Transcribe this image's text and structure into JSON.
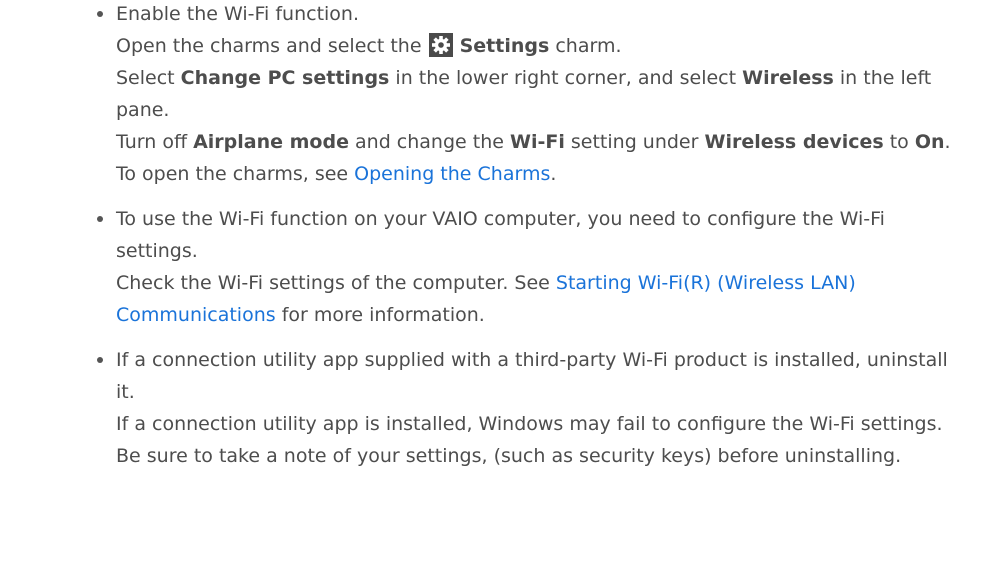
{
  "items": [
    {
      "heading": "Enable the Wi-Fi function.",
      "l1_pre": "Open the charms and select the ",
      "l1_bold": "Settings",
      "l1_post": " charm.",
      "l2_pre": "Select ",
      "l2_bold1": "Change PC settings",
      "l2_mid": " in the lower right corner, and select ",
      "l2_bold2": "Wireless",
      "l2_post": " in the left pane.",
      "l3_pre": "Turn off ",
      "l3_bold1": "Airplane mode",
      "l3_mid1": " and change the ",
      "l3_bold2": "Wi-Fi",
      "l3_mid2": " setting under ",
      "l3_bold3": "Wireless devices",
      "l3_mid3": " to ",
      "l3_bold4": "On",
      "l3_post": ".",
      "l4_pre": "To open the charms, see ",
      "l4_link": "Opening the Charms",
      "l4_post": ".",
      "settings_icon": "gear-icon"
    },
    {
      "heading": "To use the Wi-Fi function on your VAIO computer, you need to configure the Wi-Fi settings.",
      "l1_pre": "Check the Wi-Fi settings of the computer. See ",
      "l1_link": "Starting Wi-Fi(R) (Wireless LAN) Communications",
      "l1_post": " for more information."
    },
    {
      "heading": "If a connection utility app supplied with a third-party Wi-Fi product is installed, uninstall it.",
      "l1": "If a connection utility app is installed, Windows may fail to configure the Wi-Fi settings. Be sure to take a note of your settings, (such as security keys) before uninstalling."
    }
  ],
  "colors": {
    "text": "#4d4d4d",
    "link": "#1a73d9",
    "icon_bg": "#4a4a4a"
  }
}
